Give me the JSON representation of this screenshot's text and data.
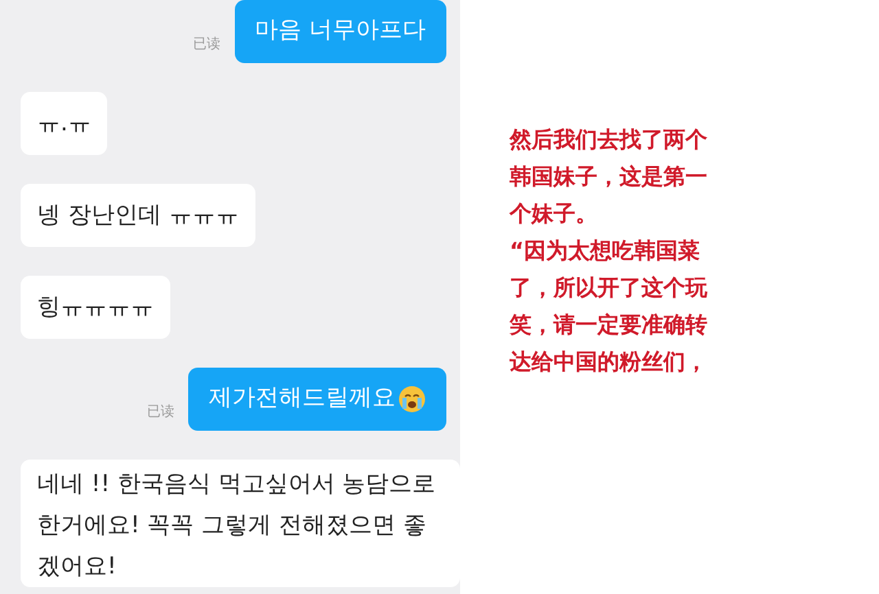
{
  "messages": [
    {
      "kind": "sent",
      "lines": [
        "마음 너무아프다"
      ],
      "read_label": "已读",
      "has_emoji": false
    },
    {
      "kind": "received",
      "lines": [
        "ㅠ.ㅠ"
      ]
    },
    {
      "kind": "received",
      "lines": [
        "넹 장난인데 ㅠㅠㅠ"
      ]
    },
    {
      "kind": "received",
      "lines": [
        "힝ㅠㅠㅠㅠ"
      ]
    },
    {
      "kind": "sent",
      "lines": [
        "제가전해드릴께요"
      ],
      "read_label": "已读",
      "has_emoji": true
    },
    {
      "kind": "received",
      "lines": [
        "네네 !! 한국음식 먹고싶어서 농담으로",
        "한거에요! 꼭꼭 그렇게 전해졌으면 좋",
        "겠어요!"
      ]
    }
  ],
  "annotation": {
    "lines": [
      "然后我们去找了两个",
      "韩国妹子，这是第一",
      "个妹子。",
      "“因为太想吃韩国菜",
      "了，所以开了这个玩",
      "笑，请一定要准确转",
      "达给中国的粉丝们，"
    ]
  }
}
